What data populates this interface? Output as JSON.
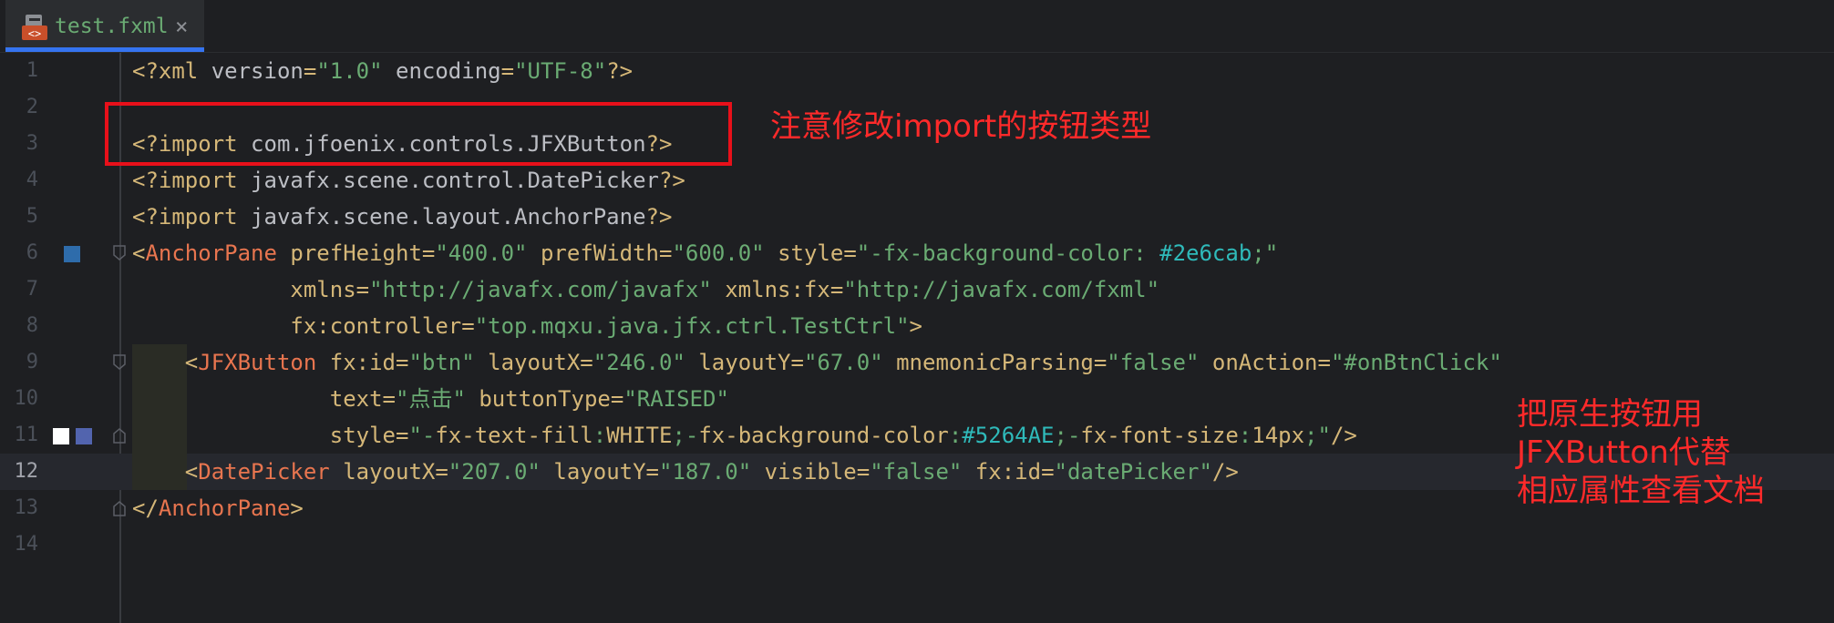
{
  "tab": {
    "file_name": "test.fxml",
    "close_glyph": "×",
    "icon": "fxml-file-icon"
  },
  "colors": {
    "accent": "#3574f0",
    "annotation": "#ff2a2a",
    "swatch_bg": "#2e6cab",
    "swatch_btn": "#5264AE"
  },
  "lines": [
    {
      "n": "1",
      "segments": [
        [
          "pi",
          "<?xml "
        ],
        [
          "attr",
          "version"
        ],
        [
          "pi",
          "="
        ],
        [
          "val",
          "\"1.0\""
        ],
        [
          "attr",
          " encoding"
        ],
        [
          "pi",
          "="
        ],
        [
          "val",
          "\"UTF-8\""
        ],
        [
          "pi",
          "?>"
        ]
      ]
    },
    {
      "n": "2",
      "segments": []
    },
    {
      "n": "3",
      "segments": [
        [
          "pi",
          "<?import "
        ],
        [
          "cls",
          "com.jfoenix.controls.JFXButton"
        ],
        [
          "pi",
          "?>"
        ]
      ]
    },
    {
      "n": "4",
      "segments": [
        [
          "pi",
          "<?import "
        ],
        [
          "cls",
          "javafx.scene.control.DatePicker"
        ],
        [
          "pi",
          "?>"
        ]
      ]
    },
    {
      "n": "5",
      "segments": [
        [
          "pi",
          "<?import "
        ],
        [
          "cls",
          "javafx.scene.layout.AnchorPane"
        ],
        [
          "pi",
          "?>"
        ]
      ]
    },
    {
      "n": "6",
      "segments": [
        [
          "tag",
          "<"
        ],
        [
          "tagname",
          "AnchorPane"
        ],
        [
          "attrname",
          " prefHeight"
        ],
        [
          "tag",
          "="
        ],
        [
          "val",
          "\"400.0\""
        ],
        [
          "attrname",
          " prefWidth"
        ],
        [
          "tag",
          "="
        ],
        [
          "val",
          "\"600.0\""
        ],
        [
          "attrname",
          " style"
        ],
        [
          "tag",
          "="
        ],
        [
          "val",
          "\"-fx-background-color: "
        ],
        [
          "hex",
          "#2e6cab"
        ],
        [
          "val",
          ";\""
        ]
      ]
    },
    {
      "n": "7",
      "segments": [
        [
          "attrname",
          "            xmlns"
        ],
        [
          "tag",
          "="
        ],
        [
          "val",
          "\"http://javafx.com/javafx\""
        ],
        [
          "attrname",
          " xmlns:fx"
        ],
        [
          "tag",
          "="
        ],
        [
          "val",
          "\"http://javafx.com/fxml\""
        ]
      ]
    },
    {
      "n": "8",
      "segments": [
        [
          "attrname",
          "            fx:controller"
        ],
        [
          "tag",
          "="
        ],
        [
          "val",
          "\"top.mqxu.java.jfx.ctrl.TestCtrl\""
        ],
        [
          "tag",
          ">"
        ]
      ]
    },
    {
      "n": "9",
      "segments": [
        [
          "tag",
          "    <"
        ],
        [
          "tagname",
          "JFXButton"
        ],
        [
          "attrname",
          " fx:id"
        ],
        [
          "tag",
          "="
        ],
        [
          "val",
          "\"btn\""
        ],
        [
          "attrname",
          " layoutX"
        ],
        [
          "tag",
          "="
        ],
        [
          "val",
          "\"246.0\""
        ],
        [
          "attrname",
          " layoutY"
        ],
        [
          "tag",
          "="
        ],
        [
          "val",
          "\"67.0\""
        ],
        [
          "attrname",
          " mnemonicParsing"
        ],
        [
          "tag",
          "="
        ],
        [
          "val",
          "\"false\""
        ],
        [
          "attrname",
          " onAction"
        ],
        [
          "tag",
          "="
        ],
        [
          "val",
          "\"#onBtnClick\""
        ]
      ]
    },
    {
      "n": "10",
      "segments": [
        [
          "attrname",
          "               text"
        ],
        [
          "tag",
          "="
        ],
        [
          "val",
          "\"点击\""
        ],
        [
          "attrname",
          " buttonType"
        ],
        [
          "tag",
          "="
        ],
        [
          "val",
          "\"RAISED\""
        ]
      ]
    },
    {
      "n": "11",
      "segments": [
        [
          "attrname",
          "               style"
        ],
        [
          "tag",
          "="
        ],
        [
          "val",
          "\"-"
        ],
        [
          "attrname",
          "fx-text-fill"
        ],
        [
          "val",
          ":"
        ],
        [
          "attrname",
          "WHITE"
        ],
        [
          "val",
          ";-"
        ],
        [
          "attrname",
          "fx-background-color"
        ],
        [
          "val",
          ":"
        ],
        [
          "hex",
          "#5264AE"
        ],
        [
          "val",
          ";-"
        ],
        [
          "attrname",
          "fx-font-size"
        ],
        [
          "val",
          ":"
        ],
        [
          "num",
          "14px"
        ],
        [
          "val",
          ";\""
        ],
        [
          "tag",
          "/>"
        ]
      ]
    },
    {
      "n": "12",
      "segments": [
        [
          "tag",
          "    <"
        ],
        [
          "tagname",
          "DatePicker"
        ],
        [
          "attrname",
          " layoutX"
        ],
        [
          "tag",
          "="
        ],
        [
          "val",
          "\"207.0\""
        ],
        [
          "attrname",
          " layoutY"
        ],
        [
          "tag",
          "="
        ],
        [
          "val",
          "\"187.0\""
        ],
        [
          "attrname",
          " visible"
        ],
        [
          "tag",
          "="
        ],
        [
          "val",
          "\"false\""
        ],
        [
          "attrname",
          " fx:id"
        ],
        [
          "tag",
          "="
        ],
        [
          "val",
          "\"datePicker\""
        ],
        [
          "tag",
          "/>"
        ]
      ]
    },
    {
      "n": "13",
      "segments": [
        [
          "tag",
          "</"
        ],
        [
          "tagname",
          "AnchorPane"
        ],
        [
          "tag",
          ">"
        ]
      ]
    },
    {
      "n": "14",
      "segments": []
    }
  ],
  "annotations": {
    "import_note": "注意修改import的按钮类型",
    "replace_note": "把原生按钮用\nJFXButton代替\n相应属性查看文档"
  }
}
